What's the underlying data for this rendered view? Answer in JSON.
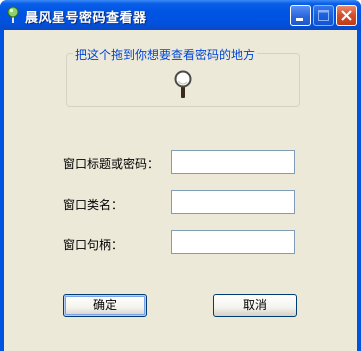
{
  "window": {
    "title": "晨风星号密码查看器",
    "icon": "pin-icon",
    "controls": [
      "minimize-icon",
      "maximize-icon",
      "close-icon"
    ]
  },
  "groupbox": {
    "title": "把这个拖到你想要查看密码的地方",
    "icon": "magnifier-icon"
  },
  "fields": {
    "password_label": "窗口标题或密码：",
    "password_value": "",
    "class_label": "窗口类名：",
    "class_value": "",
    "handle_label": "窗口句柄：",
    "handle_value": ""
  },
  "buttons": {
    "ok": "确定",
    "cancel": "取消"
  },
  "colors": {
    "titlebar": "#0054e3",
    "client": "#ece9d8",
    "group_title": "#0046d5",
    "close_button": "#d6502e"
  }
}
